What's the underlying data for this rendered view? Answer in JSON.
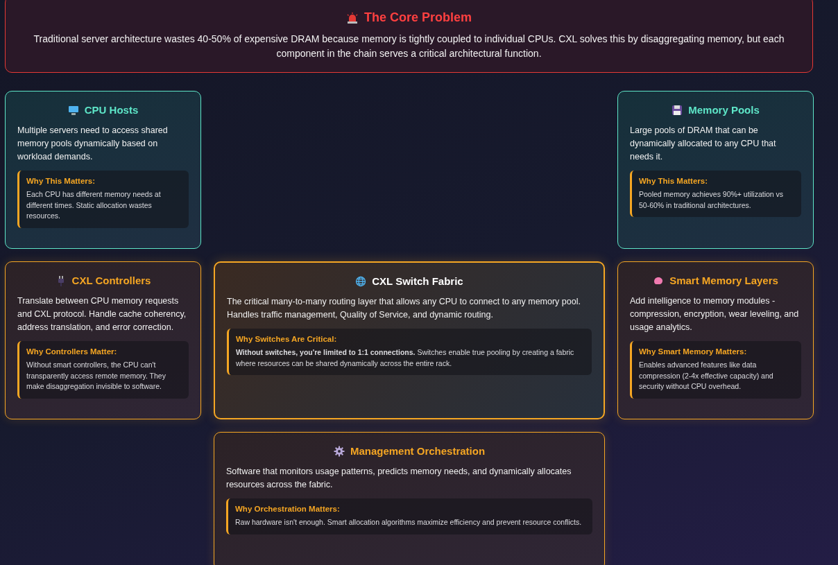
{
  "banner": {
    "title": "The Core Problem",
    "text": "Traditional server architecture wastes 40-50% of expensive DRAM because memory is tightly coupled to individual CPUs. CXL solves this by disaggregating memory, but each component in the chain serves a critical architectural function."
  },
  "cards": [
    {
      "kind": "endpoint",
      "title": "CPU Hosts",
      "text": "Multiple servers need to access shared memory pools dynamically based on workload demands.",
      "note_title": "Why This Matters:",
      "note": "Each CPU has different memory needs at different times. Static allocation wastes resources."
    },
    {
      "kind": "endpoint",
      "title": "Memory Pools",
      "text": "Large pools of DRAM that can be dynamically allocated to any CPU that needs it.",
      "note_title": "Why This Matters:",
      "note": "Pooled memory achieves 90%+ utilization vs 50-60% in traditional architectures."
    },
    {
      "kind": "layer",
      "title": "CXL Controllers",
      "text": "Translate between CPU memory requests and CXL protocol. Handle cache coherency, address translation, and error correction.",
      "note_title": "Why Controllers Matter:",
      "note": "Without smart controllers, the CPU can't transparently access remote memory. They make disaggregation invisible to software."
    },
    {
      "kind": "core",
      "title": "CXL Switch Fabric",
      "text": "The critical many-to-many routing layer that allows any CPU to connect to any memory pool. Handles traffic management, Quality of Service, and dynamic routing.",
      "note_title": "Why Switches Are Critical:",
      "note": "**Without switches, you're limited to 1:1 connections.** Switches enable true pooling by creating a fabric where resources can be shared dynamically across the entire rack."
    },
    {
      "kind": "layer",
      "title": "Smart Memory Layers",
      "text": "Add intelligence to memory modules - compression, encryption, wear leveling, and usage analytics.",
      "note_title": "Why Smart Memory Matters:",
      "note": "Enables advanced features like data compression (2-4x effective capacity) and security without CPU overhead."
    },
    {
      "kind": "layer",
      "title": "Management Orchestration",
      "text": "Software that monitors usage patterns, predicts memory needs, and dynamically allocates resources across the fabric.",
      "note_title": "Why Orchestration Matters:",
      "note": "Raw hardware isn't enough. Smart allocation algorithms maximize efficiency and prevent resource conflicts."
    }
  ]
}
